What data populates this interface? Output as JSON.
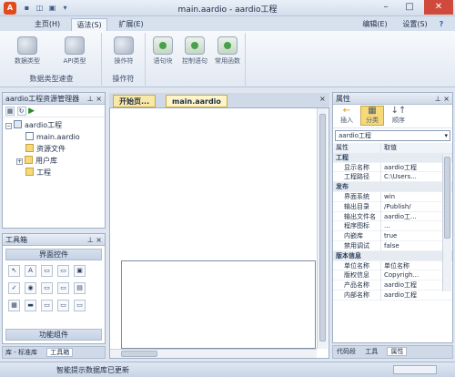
{
  "window": {
    "title": "main.aardio - aardio工程",
    "controls": [
      "–",
      "□",
      "✕"
    ]
  },
  "quick_access": [
    "▪",
    "◫",
    "▣",
    "▾"
  ],
  "ribbon_tabs": [
    "主页(H)",
    "语法(S)",
    "扩展(E)"
  ],
  "ribbon_right": {
    "edit": "编辑(E)",
    "settings": "设置(S)",
    "help": "?"
  },
  "ribbon": {
    "group1": {
      "buttons": [
        "数据类型",
        "API类型"
      ],
      "label": "数据类型速查"
    },
    "group2": {
      "buttons": [
        "操作符"
      ],
      "label": "操作符"
    },
    "group3": {
      "buttons": [
        "语句块",
        "控制语句",
        "常用函数"
      ]
    }
  },
  "project_panel": {
    "title": "aardio工程资源管理器",
    "pin": "⊥ ×"
  },
  "project_tree": {
    "root": "aardio工程",
    "items": [
      "main.aardio",
      "资源文件",
      "用户库",
      "工程"
    ]
  },
  "toolbox_panel": {
    "title": "工具箱",
    "section1": "界面控件",
    "section2": "功能组件",
    "tools": [
      "↖",
      "A",
      "▭",
      "▭",
      "▣",
      "✓",
      "◉",
      "▭",
      "▭",
      "▤",
      "▦",
      "▬",
      "▭",
      "▭",
      "▭"
    ]
  },
  "left_bottom_tabs": {
    "tab1": "库 - 标准库",
    "tab2": "工具箱"
  },
  "doc_tabs": {
    "tab1": "开始页...",
    "tab2": "main.aardio"
  },
  "properties_panel": {
    "title": "属性",
    "tools": {
      "insert": "插入",
      "category": "分类",
      "order": "顺序"
    },
    "selector": "aardio工程",
    "header_key": "属性",
    "header_val": "取值",
    "rows": [
      {
        "cat": true,
        "k": "工程"
      },
      {
        "k": "显示名称",
        "v": "aardio工程"
      },
      {
        "k": "工程路径",
        "v": "C:\\Users..."
      },
      {
        "cat": true,
        "k": "发布"
      },
      {
        "k": "界面系统",
        "v": "win"
      },
      {
        "k": "输出目录",
        "v": "/Publish/"
      },
      {
        "k": "输出文件名",
        "v": "aardio工..."
      },
      {
        "k": "程序图标",
        "v": "..."
      },
      {
        "k": "内嵌库",
        "v": "true"
      },
      {
        "k": "禁用调试",
        "v": "false"
      },
      {
        "cat": true,
        "k": "版本信息"
      },
      {
        "k": "单位名称",
        "v": "单位名称"
      },
      {
        "k": "版权信息",
        "v": "Copyrigh..."
      },
      {
        "k": "产品名称",
        "v": "aardio工程"
      },
      {
        "k": "内部名称",
        "v": "aardio工程"
      }
    ]
  },
  "right_bottom_tabs": {
    "tab1": "代码段",
    "tab2": "工具",
    "tab3": "属性"
  },
  "status": {
    "text": "智能提示数据库已更新"
  }
}
